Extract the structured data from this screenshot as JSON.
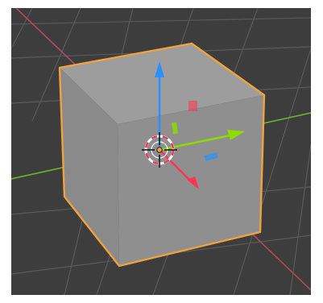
{
  "viewport": {
    "background": "#3d3d3d",
    "grid_color": "#5a5a5a",
    "x_axis_color": "#b34a5c",
    "y_axis_color": "#6fb32c"
  },
  "object": {
    "selected": true,
    "outline_color": "#f0a33c",
    "face_front": "#8f8f8f",
    "face_top": "#9d9d9d",
    "face_side": "#858585"
  },
  "gizmo": {
    "x_color": "#ff3352",
    "y_color": "#8bdc00",
    "z_color": "#2890ff",
    "icons": [
      "move-gizmo-icon",
      "3d-cursor-icon",
      "origin-dot-icon"
    ]
  }
}
